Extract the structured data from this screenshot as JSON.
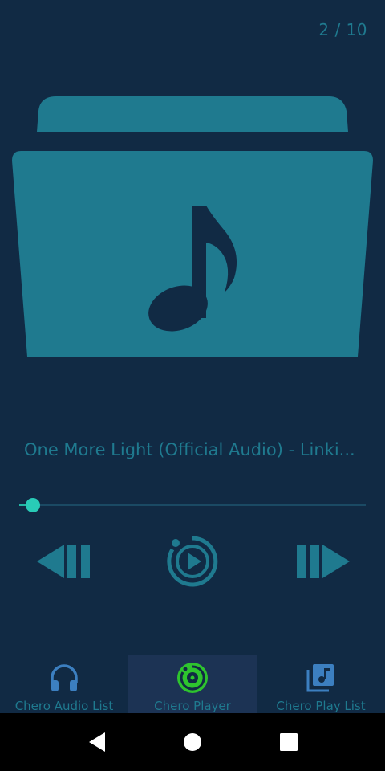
{
  "player": {
    "track_counter": "2 / 10",
    "track_title": "One More Light (Official Audio) - Linki...",
    "progress": 0.04,
    "controls": {
      "prev_icon": "skip-previous-icon",
      "play_icon": "play-circle-icon",
      "next_icon": "skip-next-icon"
    },
    "album_art_icon": "folder-music-icon"
  },
  "bottom_nav": {
    "tabs": [
      {
        "label": "Chero Audio List",
        "icon": "headphones-icon",
        "active": false
      },
      {
        "label": "Chero Player",
        "icon": "disc-icon",
        "active": true
      },
      {
        "label": "Chero Play List",
        "icon": "music-library-icon",
        "active": false
      }
    ]
  },
  "colors": {
    "background": "#112a44",
    "accent": "#1f7a8f",
    "seek_accent": "#29cbb7",
    "active_icon": "#2ec42e",
    "active_tab_bg": "#1c3354",
    "library_icon": "#3c7fc0"
  }
}
